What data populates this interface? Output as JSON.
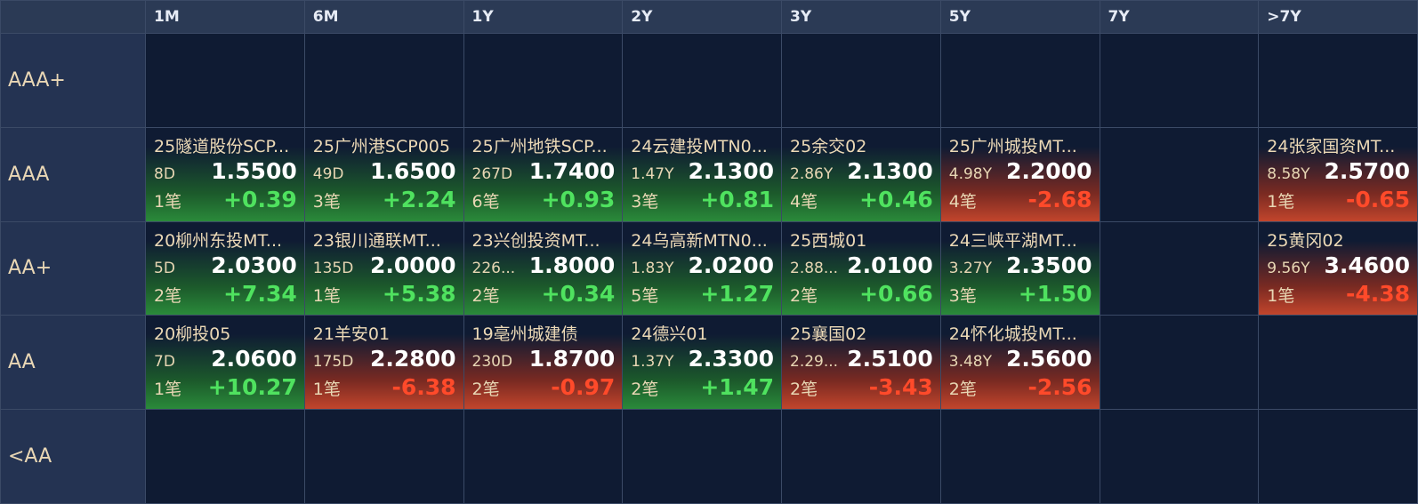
{
  "columns": [
    "1M",
    "6M",
    "1Y",
    "2Y",
    "3Y",
    "5Y",
    "7Y",
    ">7Y"
  ],
  "rows": [
    {
      "label": "AAA+",
      "cells": [
        null,
        null,
        null,
        null,
        null,
        null,
        null,
        null
      ]
    },
    {
      "label": "AAA",
      "cells": [
        {
          "name": "25隧道股份SCP...",
          "tenor": "8D",
          "price": "1.5500",
          "count": "1笔",
          "change": "+0.39",
          "dir": "up"
        },
        {
          "name": "25广州港SCP005",
          "tenor": "49D",
          "price": "1.6500",
          "count": "3笔",
          "change": "+2.24",
          "dir": "up"
        },
        {
          "name": "25广州地铁SCP...",
          "tenor": "267D",
          "price": "1.7400",
          "count": "6笔",
          "change": "+0.93",
          "dir": "up"
        },
        {
          "name": "24云建投MTN0...",
          "tenor": "1.47Y",
          "price": "2.1300",
          "count": "3笔",
          "change": "+0.81",
          "dir": "up"
        },
        {
          "name": "25余交02",
          "tenor": "2.86Y",
          "price": "2.1300",
          "count": "4笔",
          "change": "+0.46",
          "dir": "up"
        },
        {
          "name": "25广州城投MT...",
          "tenor": "4.98Y",
          "price": "2.2000",
          "count": "4笔",
          "change": "-2.68",
          "dir": "down"
        },
        null,
        {
          "name": "24张家国资MT...",
          "tenor": "8.58Y",
          "price": "2.5700",
          "count": "1笔",
          "change": "-0.65",
          "dir": "down"
        }
      ]
    },
    {
      "label": "AA+",
      "cells": [
        {
          "name": "20柳州东投MT...",
          "tenor": "5D",
          "price": "2.0300",
          "count": "2笔",
          "change": "+7.34",
          "dir": "up"
        },
        {
          "name": "23银川通联MT...",
          "tenor": "135D",
          "price": "2.0000",
          "count": "1笔",
          "change": "+5.38",
          "dir": "up"
        },
        {
          "name": "23兴创投资MT...",
          "tenor": "226...",
          "price": "1.8000",
          "count": "2笔",
          "change": "+0.34",
          "dir": "up"
        },
        {
          "name": "24乌高新MTN0...",
          "tenor": "1.83Y",
          "price": "2.0200",
          "count": "5笔",
          "change": "+1.27",
          "dir": "up"
        },
        {
          "name": "25西城01",
          "tenor": "2.88...",
          "price": "2.0100",
          "count": "2笔",
          "change": "+0.66",
          "dir": "up"
        },
        {
          "name": "24三峡平湖MT...",
          "tenor": "3.27Y",
          "price": "2.3500",
          "count": "3笔",
          "change": "+1.50",
          "dir": "up"
        },
        null,
        {
          "name": "25黄冈02",
          "tenor": "9.56Y",
          "price": "3.4600",
          "count": "1笔",
          "change": "-4.38",
          "dir": "down"
        }
      ]
    },
    {
      "label": "AA",
      "cells": [
        {
          "name": "20柳投05",
          "tenor": "7D",
          "price": "2.0600",
          "count": "1笔",
          "change": "+10.27",
          "dir": "up"
        },
        {
          "name": "21羊安01",
          "tenor": "175D",
          "price": "2.2800",
          "count": "1笔",
          "change": "-6.38",
          "dir": "down"
        },
        {
          "name": "19亳州城建债",
          "tenor": "230D",
          "price": "1.8700",
          "count": "2笔",
          "change": "-0.97",
          "dir": "down"
        },
        {
          "name": "24德兴01",
          "tenor": "1.37Y",
          "price": "2.3300",
          "count": "2笔",
          "change": "+1.47",
          "dir": "up"
        },
        {
          "name": "25襄国02",
          "tenor": "2.29...",
          "price": "2.5100",
          "count": "2笔",
          "change": "-3.43",
          "dir": "down"
        },
        {
          "name": "24怀化城投MT...",
          "tenor": "3.48Y",
          "price": "2.5600",
          "count": "2笔",
          "change": "-2.56",
          "dir": "down"
        },
        null,
        null
      ]
    },
    {
      "label": "<AA",
      "cells": [
        null,
        null,
        null,
        null,
        null,
        null,
        null,
        null
      ]
    }
  ]
}
